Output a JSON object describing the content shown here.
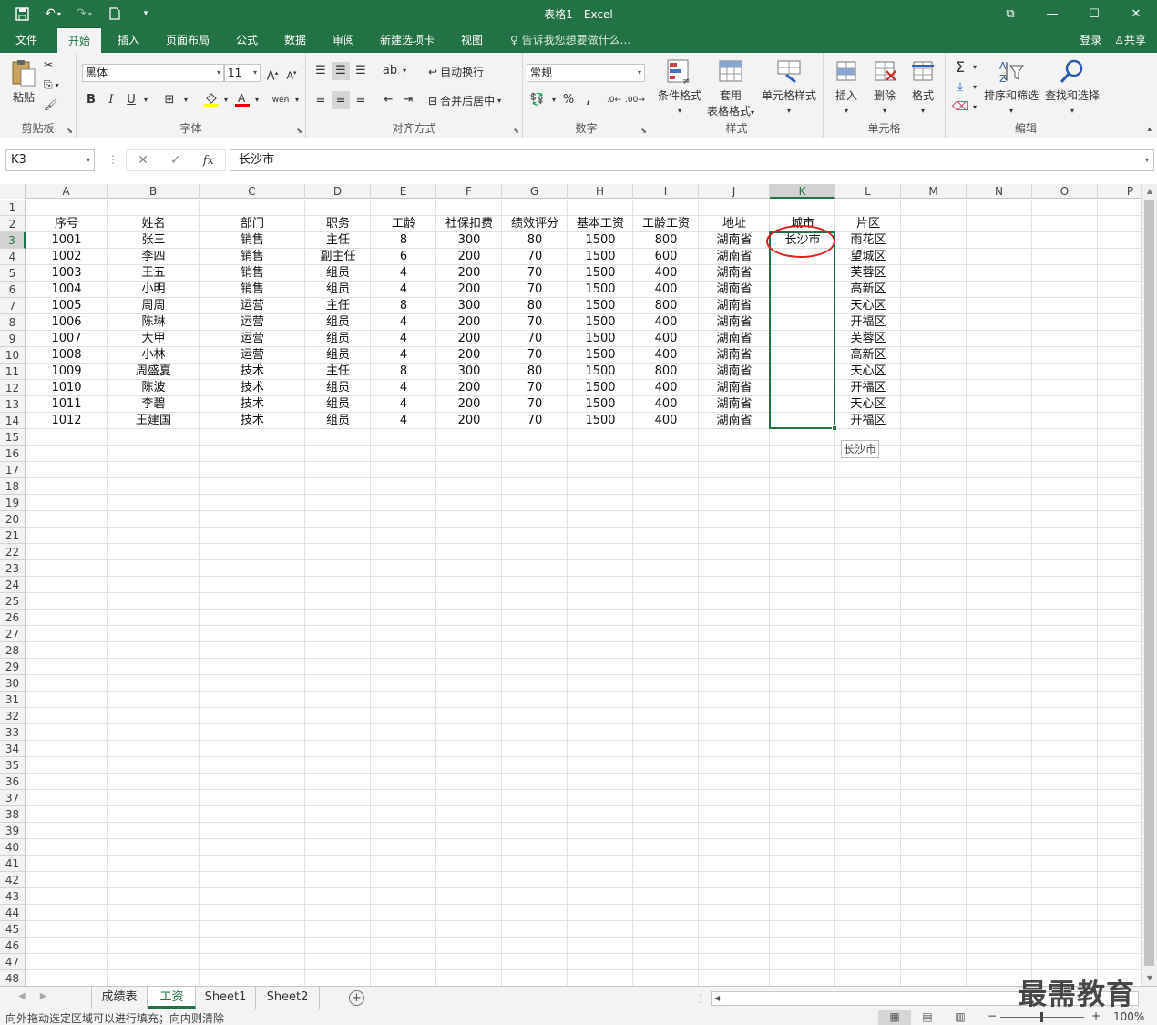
{
  "window": {
    "title": "表格1 - Excel",
    "controls": {
      "restore": "⧉",
      "minimize": "—",
      "maximize": "☐",
      "close": "✕"
    }
  },
  "qat": {
    "save_icon": "save-icon",
    "undo_icon": "undo-icon",
    "redo_icon": "redo-icon",
    "new_icon": "new-file-icon"
  },
  "tabs": [
    {
      "label": "文件"
    },
    {
      "label": "开始"
    },
    {
      "label": "插入"
    },
    {
      "label": "页面布局"
    },
    {
      "label": "公式"
    },
    {
      "label": "数据"
    },
    {
      "label": "审阅"
    },
    {
      "label": "新建选项卡"
    },
    {
      "label": "视图"
    }
  ],
  "tell_me": "告诉我您想要做什么...",
  "account": {
    "signin": "登录",
    "share": "共享"
  },
  "ribbon": {
    "clipboard": {
      "label": "剪贴板",
      "paste": "粘贴"
    },
    "font": {
      "label": "字体",
      "font_name": "黑体",
      "font_size": "11",
      "bold": "B",
      "italic": "I",
      "underline": "U"
    },
    "alignment": {
      "label": "对齐方式",
      "wrap": "自动换行",
      "merge": "合并后居中"
    },
    "number": {
      "label": "数字",
      "format": "常规",
      "percent": "%",
      "comma": ","
    },
    "styles": {
      "label": "样式",
      "conditional": "条件格式",
      "table_l1": "套用",
      "table_l2": "表格格式",
      "cell_styles": "单元格样式"
    },
    "cells": {
      "label": "单元格",
      "insert": "插入",
      "delete": "删除",
      "format": "格式"
    },
    "editing": {
      "label": "编辑",
      "sort": "排序和筛选",
      "find": "查找和选择"
    }
  },
  "formula_bar": {
    "name_box": "K3",
    "fx": "fx",
    "content": "长沙市"
  },
  "columns": [
    "A",
    "B",
    "C",
    "D",
    "E",
    "F",
    "G",
    "H",
    "I",
    "J",
    "K",
    "L",
    "M",
    "N",
    "O",
    "P"
  ],
  "selected_column": "K",
  "row_count": 48,
  "selected_row": 3,
  "table": {
    "headers": [
      "序号",
      "姓名",
      "部门",
      "职务",
      "工龄",
      "社保扣费",
      "绩效评分",
      "基本工资",
      "工龄工资",
      "地址",
      "城市",
      "片区"
    ],
    "rows": [
      [
        "1001",
        "张三",
        "销售",
        "主任",
        "8",
        "300",
        "80",
        "1500",
        "800",
        "湖南省",
        "长沙市",
        "雨花区"
      ],
      [
        "1002",
        "李四",
        "销售",
        "副主任",
        "6",
        "200",
        "70",
        "1500",
        "600",
        "湖南省",
        "",
        "望城区"
      ],
      [
        "1003",
        "王五",
        "销售",
        "组员",
        "4",
        "200",
        "70",
        "1500",
        "400",
        "湖南省",
        "",
        "芙蓉区"
      ],
      [
        "1004",
        "小明",
        "销售",
        "组员",
        "4",
        "200",
        "70",
        "1500",
        "400",
        "湖南省",
        "",
        "高新区"
      ],
      [
        "1005",
        "周周",
        "运营",
        "主任",
        "8",
        "300",
        "80",
        "1500",
        "800",
        "湖南省",
        "",
        "天心区"
      ],
      [
        "1006",
        "陈琳",
        "运营",
        "组员",
        "4",
        "200",
        "70",
        "1500",
        "400",
        "湖南省",
        "",
        "开福区"
      ],
      [
        "1007",
        "大甲",
        "运营",
        "组员",
        "4",
        "200",
        "70",
        "1500",
        "400",
        "湖南省",
        "",
        "芙蓉区"
      ],
      [
        "1008",
        "小林",
        "运营",
        "组员",
        "4",
        "200",
        "70",
        "1500",
        "400",
        "湖南省",
        "",
        "高新区"
      ],
      [
        "1009",
        "周盛夏",
        "技术",
        "主任",
        "8",
        "300",
        "80",
        "1500",
        "800",
        "湖南省",
        "",
        "天心区"
      ],
      [
        "1010",
        "陈波",
        "技术",
        "组员",
        "4",
        "200",
        "70",
        "1500",
        "400",
        "湖南省",
        "",
        "开福区"
      ],
      [
        "1011",
        "李碧",
        "技术",
        "组员",
        "4",
        "200",
        "70",
        "1500",
        "400",
        "湖南省",
        "",
        "天心区"
      ],
      [
        "1012",
        "王建国",
        "技术",
        "组员",
        "4",
        "200",
        "70",
        "1500",
        "400",
        "湖南省",
        "",
        "开福区"
      ]
    ]
  },
  "fill_tooltip": "长沙市",
  "sheets": [
    {
      "label": "成绩表"
    },
    {
      "label": "工资"
    },
    {
      "label": "Sheet1"
    },
    {
      "label": "Sheet2"
    }
  ],
  "active_sheet": "工资",
  "status": {
    "message": "向外拖动选定区域可以进行填充；向内则清除",
    "zoom": "100%"
  },
  "watermark": "最需教育",
  "colors": {
    "accent": "#217346",
    "highlight": "#e02020"
  }
}
